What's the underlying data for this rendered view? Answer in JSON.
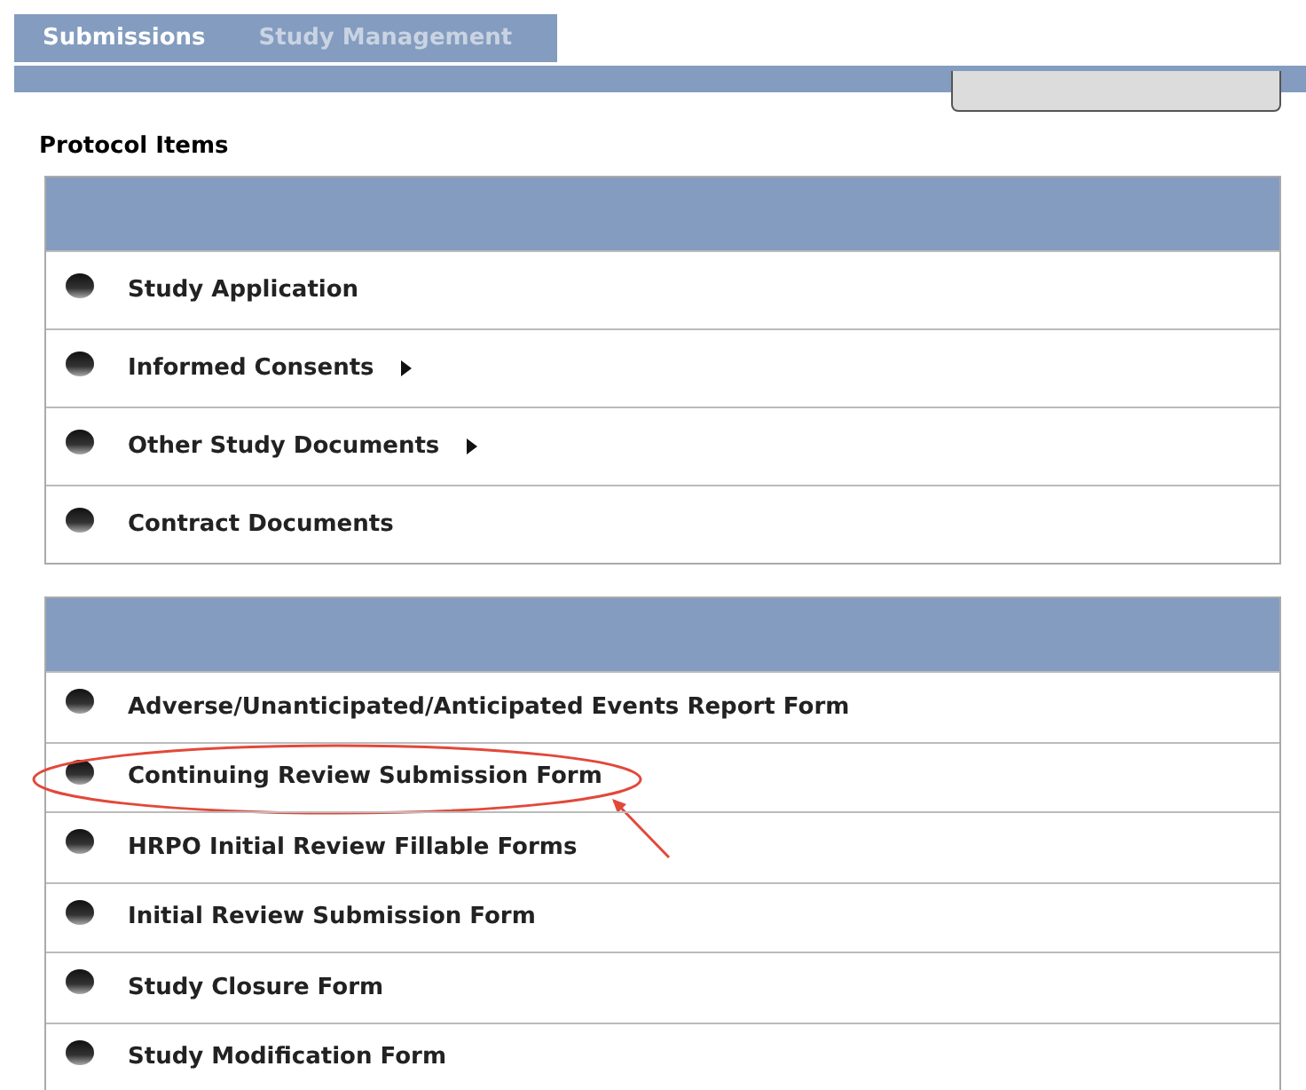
{
  "tabs": [
    {
      "label": "Submissions",
      "selected": true
    },
    {
      "label": "Study Management",
      "selected": false
    }
  ],
  "section_title": "Protocol Items",
  "panels": [
    {
      "items": [
        {
          "label": "Study Application",
          "has_submenu": false,
          "circled": false
        },
        {
          "label": "Informed Consents",
          "has_submenu": true,
          "circled": false
        },
        {
          "label": "Other Study Documents",
          "has_submenu": true,
          "circled": false
        },
        {
          "label": "Contract Documents",
          "has_submenu": false,
          "circled": false
        }
      ]
    },
    {
      "items": [
        {
          "label": "Adverse/Unanticipated/Anticipated Events Report Form",
          "has_submenu": false,
          "circled": false
        },
        {
          "label": "Continuing Review Submission Form",
          "has_submenu": false,
          "circled": true
        },
        {
          "label": "HRPO Initial Review Fillable Forms",
          "has_submenu": false,
          "circled": false
        },
        {
          "label": "Initial Review Submission Form",
          "has_submenu": false,
          "circled": false
        },
        {
          "label": "Study Closure Form",
          "has_submenu": false,
          "circled": false
        },
        {
          "label": "Study Modification Form",
          "has_submenu": false,
          "circled": false
        }
      ]
    }
  ]
}
